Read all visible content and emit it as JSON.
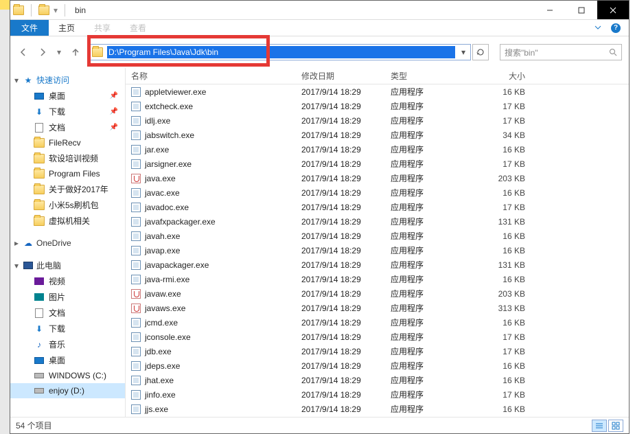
{
  "title": "bin",
  "ribbon": {
    "file": "文件",
    "home": "主页",
    "tabs_extra": [
      "共享",
      "查看"
    ]
  },
  "nav": {
    "path": "D:\\Program Files\\Java\\Jdk\\bin",
    "search_placeholder": "搜索\"bin\""
  },
  "columns": {
    "name": "名称",
    "date": "修改日期",
    "type": "类型",
    "size": "大小"
  },
  "sidebar": {
    "quick": {
      "label": "快速访问",
      "items": [
        {
          "label": "桌面",
          "pin": true,
          "icon": "desktop"
        },
        {
          "label": "下载",
          "pin": true,
          "icon": "download"
        },
        {
          "label": "文档",
          "pin": true,
          "icon": "doc"
        },
        {
          "label": "FileRecv",
          "icon": "folder"
        },
        {
          "label": "软设培训视频",
          "icon": "folder"
        },
        {
          "label": "Program Files",
          "icon": "folder"
        },
        {
          "label": "关于做好2017年",
          "icon": "folder"
        },
        {
          "label": "小米5s刷机包",
          "icon": "folder"
        },
        {
          "label": "虚拟机相关",
          "icon": "folder"
        }
      ]
    },
    "onedrive": "OneDrive",
    "pc": {
      "label": "此电脑",
      "items": [
        {
          "label": "视频",
          "icon": "video"
        },
        {
          "label": "图片",
          "icon": "pic"
        },
        {
          "label": "文档",
          "icon": "doc"
        },
        {
          "label": "下载",
          "icon": "download"
        },
        {
          "label": "音乐",
          "icon": "music"
        },
        {
          "label": "桌面",
          "icon": "desktop"
        },
        {
          "label": "WINDOWS (C:)",
          "icon": "drive"
        },
        {
          "label": "enjoy (D:)",
          "icon": "drive",
          "selected": true
        }
      ]
    }
  },
  "files": [
    {
      "name": "appletviewer.exe",
      "date": "2017/9/14 18:29",
      "type": "应用程序",
      "size": "16 KB",
      "icon": "app"
    },
    {
      "name": "extcheck.exe",
      "date": "2017/9/14 18:29",
      "type": "应用程序",
      "size": "17 KB",
      "icon": "app"
    },
    {
      "name": "idlj.exe",
      "date": "2017/9/14 18:29",
      "type": "应用程序",
      "size": "17 KB",
      "icon": "app"
    },
    {
      "name": "jabswitch.exe",
      "date": "2017/9/14 18:29",
      "type": "应用程序",
      "size": "34 KB",
      "icon": "app"
    },
    {
      "name": "jar.exe",
      "date": "2017/9/14 18:29",
      "type": "应用程序",
      "size": "16 KB",
      "icon": "app"
    },
    {
      "name": "jarsigner.exe",
      "date": "2017/9/14 18:29",
      "type": "应用程序",
      "size": "17 KB",
      "icon": "app"
    },
    {
      "name": "java.exe",
      "date": "2017/9/14 18:29",
      "type": "应用程序",
      "size": "203 KB",
      "icon": "java"
    },
    {
      "name": "javac.exe",
      "date": "2017/9/14 18:29",
      "type": "应用程序",
      "size": "16 KB",
      "icon": "app"
    },
    {
      "name": "javadoc.exe",
      "date": "2017/9/14 18:29",
      "type": "应用程序",
      "size": "17 KB",
      "icon": "app"
    },
    {
      "name": "javafxpackager.exe",
      "date": "2017/9/14 18:29",
      "type": "应用程序",
      "size": "131 KB",
      "icon": "app"
    },
    {
      "name": "javah.exe",
      "date": "2017/9/14 18:29",
      "type": "应用程序",
      "size": "16 KB",
      "icon": "app"
    },
    {
      "name": "javap.exe",
      "date": "2017/9/14 18:29",
      "type": "应用程序",
      "size": "16 KB",
      "icon": "app"
    },
    {
      "name": "javapackager.exe",
      "date": "2017/9/14 18:29",
      "type": "应用程序",
      "size": "131 KB",
      "icon": "app"
    },
    {
      "name": "java-rmi.exe",
      "date": "2017/9/14 18:29",
      "type": "应用程序",
      "size": "16 KB",
      "icon": "app"
    },
    {
      "name": "javaw.exe",
      "date": "2017/9/14 18:29",
      "type": "应用程序",
      "size": "203 KB",
      "icon": "java"
    },
    {
      "name": "javaws.exe",
      "date": "2017/9/14 18:29",
      "type": "应用程序",
      "size": "313 KB",
      "icon": "java"
    },
    {
      "name": "jcmd.exe",
      "date": "2017/9/14 18:29",
      "type": "应用程序",
      "size": "16 KB",
      "icon": "app"
    },
    {
      "name": "jconsole.exe",
      "date": "2017/9/14 18:29",
      "type": "应用程序",
      "size": "17 KB",
      "icon": "app"
    },
    {
      "name": "jdb.exe",
      "date": "2017/9/14 18:29",
      "type": "应用程序",
      "size": "17 KB",
      "icon": "app"
    },
    {
      "name": "jdeps.exe",
      "date": "2017/9/14 18:29",
      "type": "应用程序",
      "size": "16 KB",
      "icon": "app"
    },
    {
      "name": "jhat.exe",
      "date": "2017/9/14 18:29",
      "type": "应用程序",
      "size": "16 KB",
      "icon": "app"
    },
    {
      "name": "jinfo.exe",
      "date": "2017/9/14 18:29",
      "type": "应用程序",
      "size": "17 KB",
      "icon": "app"
    },
    {
      "name": "jjs.exe",
      "date": "2017/9/14 18:29",
      "type": "应用程序",
      "size": "16 KB",
      "icon": "app"
    }
  ],
  "status": "54 个项目"
}
